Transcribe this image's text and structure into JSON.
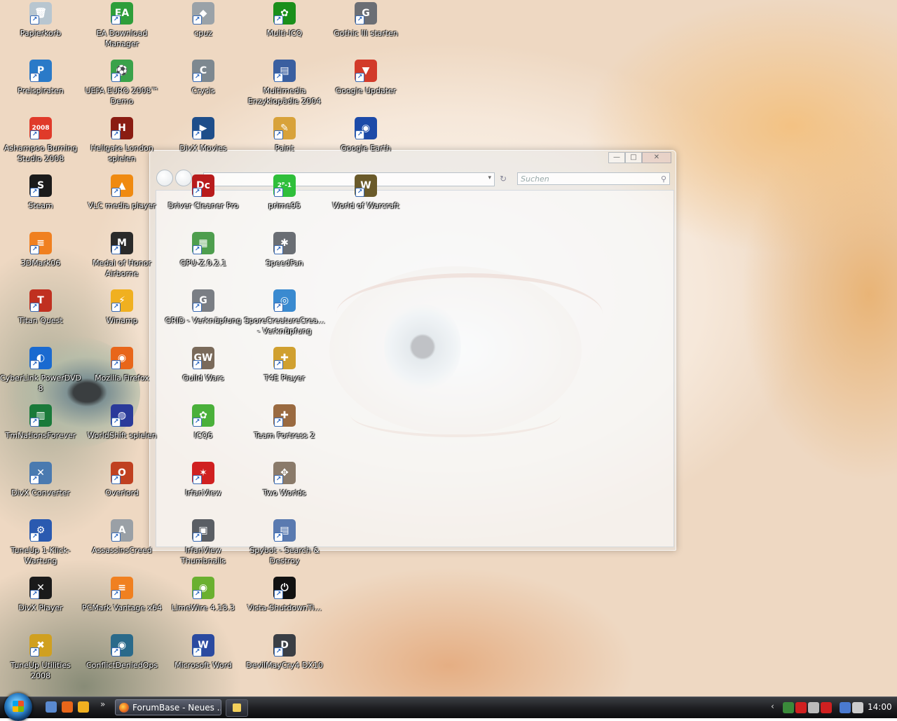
{
  "desktop": {
    "icons": [
      {
        "label": "Papierkorb",
        "icon": "recycle-bin-icon",
        "color": "#b8c6d0",
        "glyph": "🗑"
      },
      {
        "label": "EA Download Manager",
        "icon": "ea-download-icon",
        "color": "#2e9e3a",
        "glyph": "EA"
      },
      {
        "label": "cpuz",
        "icon": "cpuz-icon",
        "color": "#9aa2a8",
        "glyph": "◆"
      },
      {
        "label": "Multi-ICQ",
        "icon": "icq-flower-icon",
        "color": "#1a8f1a",
        "glyph": "✿"
      },
      {
        "label": "Gothic III starten",
        "icon": "gothic-icon",
        "color": "#6b6e74",
        "glyph": "G"
      },
      {
        "label": "Preispiraten",
        "icon": "preispiraten-icon",
        "color": "#2a7ac8",
        "glyph": "P"
      },
      {
        "label": "UEFA EURO 2008™ Demo",
        "icon": "football-icon",
        "color": "#3aa24a",
        "glyph": "⚽"
      },
      {
        "label": "Crysis",
        "icon": "crysis-icon",
        "color": "#7d8890",
        "glyph": "C"
      },
      {
        "label": "Multimedia Enzyklopädie 2004",
        "icon": "book-icon",
        "color": "#3a5fa0",
        "glyph": "▤"
      },
      {
        "label": "Google Updater",
        "icon": "google-updater-icon",
        "color": "#d23a2a",
        "glyph": "▼"
      },
      {
        "label": "Ashampoo Burning Studio 2008",
        "icon": "ashampoo-icon",
        "color": "#e03a2a",
        "glyph": "2008"
      },
      {
        "label": "Hellgate London spielen",
        "icon": "hellgate-icon",
        "color": "#8a1c12",
        "glyph": "H"
      },
      {
        "label": "DivX Movies",
        "icon": "divx-movies-icon",
        "color": "#1e4e8a",
        "glyph": "▶"
      },
      {
        "label": "Paint",
        "icon": "paint-brush-icon",
        "color": "#d8a23a",
        "glyph": "✎"
      },
      {
        "label": "Google Earth",
        "icon": "globe-icon",
        "color": "#1c4aa8",
        "glyph": "◉"
      },
      {
        "label": "Steam",
        "icon": "steam-icon",
        "color": "#1b1b1b",
        "glyph": "S"
      },
      {
        "label": "VLC media player",
        "icon": "vlc-cone-icon",
        "color": "#f08a10",
        "glyph": "▲"
      },
      {
        "label": "Driver Cleaner Pro",
        "icon": "driver-cleaner-icon",
        "color": "#b81c1c",
        "glyph": "Dc"
      },
      {
        "label": "prime95",
        "icon": "prime95-icon",
        "color": "#2fbf3a",
        "glyph": "2ᴾ-1"
      },
      {
        "label": "World of Warcraft",
        "icon": "wow-icon",
        "color": "#6a5a2a",
        "glyph": "W"
      },
      {
        "label": "3DMark06",
        "icon": "3dmark-icon",
        "color": "#f08020",
        "glyph": "≡"
      },
      {
        "label": "Medal of Honor Airborne",
        "icon": "moh-icon",
        "color": "#2a2a2a",
        "glyph": "M"
      },
      {
        "label": "GPU-Z.0.2.1",
        "icon": "gpu-card-icon",
        "color": "#4e9e4e",
        "glyph": "▦"
      },
      {
        "label": "SpeedFan",
        "icon": "speedfan-icon",
        "color": "#6a6e74",
        "glyph": "✱"
      },
      {
        "label": "Titan Quest",
        "icon": "titan-helmet-icon",
        "color": "#c03020",
        "glyph": "T"
      },
      {
        "label": "Winamp",
        "icon": "winamp-icon",
        "color": "#f0b020",
        "glyph": "⚡"
      },
      {
        "label": "GRID - Verknüpfung",
        "icon": "grid-icon",
        "color": "#7a7e84",
        "glyph": "G"
      },
      {
        "label": "SporeCreatureCrea... - Verknüpfung",
        "icon": "spore-icon",
        "color": "#3a8ad0",
        "glyph": "◎"
      },
      {
        "label": "CyberLink PowerDVD 8",
        "icon": "powerdvd-icon",
        "color": "#1a6ad0",
        "glyph": "◐"
      },
      {
        "label": "Mozilla Firefox",
        "icon": "firefox-icon",
        "color": "#e8661a",
        "glyph": "◉"
      },
      {
        "label": "Guild Wars",
        "icon": "guild-wars-icon",
        "color": "#7a6a5a",
        "glyph": "GW"
      },
      {
        "label": "T4E Player",
        "icon": "t4e-icon",
        "color": "#d0a030",
        "glyph": "✚"
      },
      {
        "label": "TmNationsForever",
        "icon": "trackmania-icon",
        "color": "#1a7a3a",
        "glyph": "▥"
      },
      {
        "label": "WorldShift spielen",
        "icon": "worldshift-icon",
        "color": "#2a3a9a",
        "glyph": "◍"
      },
      {
        "label": "ICQ6",
        "icon": "icq6-flower-icon",
        "color": "#4ab03a",
        "glyph": "✿"
      },
      {
        "label": "Team Fortress 2",
        "icon": "tf2-icon",
        "color": "#9a6a40",
        "glyph": "✚"
      },
      {
        "label": "DivX Converter",
        "icon": "divx-converter-icon",
        "color": "#4a7ab0",
        "glyph": "✕"
      },
      {
        "label": "Overlord",
        "icon": "overlord-icon",
        "color": "#c04020",
        "glyph": "O"
      },
      {
        "label": "IrfanView",
        "icon": "irfanview-icon",
        "color": "#d02020",
        "glyph": "✶"
      },
      {
        "label": "Two Worlds",
        "icon": "two-worlds-icon",
        "color": "#8a7a6a",
        "glyph": "✥"
      },
      {
        "label": "TuneUp 1-Klick-Wartung",
        "icon": "tuneup-wartung-icon",
        "color": "#2a5ab0",
        "glyph": "⚙"
      },
      {
        "label": "AssassinsCreed",
        "icon": "assassins-creed-icon",
        "color": "#9aa0a6",
        "glyph": "A"
      },
      {
        "label": "IrfanView Thumbnails",
        "icon": "irfanview-thumbs-icon",
        "color": "#5a5e64",
        "glyph": "▣"
      },
      {
        "label": "Spybot - Search & Destroy",
        "icon": "spybot-icon",
        "color": "#5a7ab0",
        "glyph": "▤"
      },
      {
        "label": "DivX Player",
        "icon": "divx-player-icon",
        "color": "#1a1a1a",
        "glyph": "✕"
      },
      {
        "label": "PCMark Vantage x64",
        "icon": "pcmark-icon",
        "color": "#f08020",
        "glyph": "≡"
      },
      {
        "label": "LimeWire 4.18.3",
        "icon": "limewire-icon",
        "color": "#6ab030",
        "glyph": "◉"
      },
      {
        "label": "Vista-ShutdownTi...",
        "icon": "shutdown-icon",
        "color": "#111111",
        "glyph": "⏻"
      },
      {
        "label": "TuneUp Utilities 2008",
        "icon": "tuneup-utilities-icon",
        "color": "#d0a020",
        "glyph": "✖"
      },
      {
        "label": "ConflictDeniedOps",
        "icon": "conflict-denied-icon",
        "color": "#2a6a8a",
        "glyph": "◉"
      },
      {
        "label": "Microsoft Word",
        "icon": "word-icon",
        "color": "#2a4aa0",
        "glyph": "W"
      },
      {
        "label": "DevilMayCry4 DX10",
        "icon": "dmc4-icon",
        "color": "#3a3e44",
        "glyph": "D"
      }
    ]
  },
  "window": {
    "search_placeholder": "Suchen",
    "minimize_glyph": "—",
    "maximize_glyph": "□",
    "close_glyph": "✕",
    "refresh_glyph": "↻",
    "dropdown_glyph": "▾",
    "search_glyph": "⚲"
  },
  "taskbar": {
    "quicklaunch_chevron": "»",
    "task_label": "ForumBase - Neues ...",
    "tray_arrow": "‹",
    "clock": "14:00",
    "colors": {
      "ql1": "#5a8ad0",
      "ql2": "#e8661a",
      "ql3": "#f0b020",
      "tr1": "#3a8a3a",
      "tr2": "#d02020",
      "tr3": "#bbbbbb",
      "tr4": "#d02020",
      "tr5": "#4a7ad0",
      "tr6": "#cccccc"
    }
  }
}
